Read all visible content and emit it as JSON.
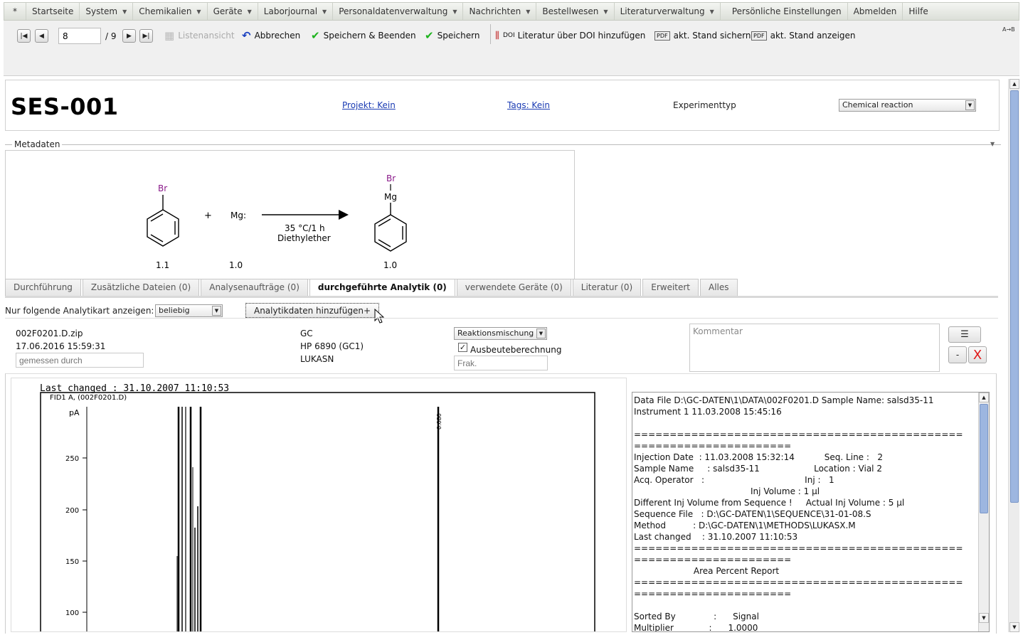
{
  "menu": {
    "items": [
      {
        "label": "*",
        "caret": false
      },
      {
        "label": "Startseite",
        "caret": false
      },
      {
        "label": "System",
        "caret": true
      },
      {
        "label": "Chemikalien",
        "caret": true
      },
      {
        "label": "Geräte",
        "caret": true
      },
      {
        "label": "Laborjournal",
        "caret": true
      },
      {
        "label": "Personaldatenverwaltung",
        "caret": true
      },
      {
        "label": "Nachrichten",
        "caret": true
      },
      {
        "label": "Bestellwesen",
        "caret": true
      },
      {
        "label": "Literaturverwaltung",
        "caret": true
      },
      {
        "label": "Persönliche Einstellungen",
        "caret": false
      },
      {
        "label": "Abmelden",
        "caret": false
      },
      {
        "label": "Hilfe",
        "caret": false
      }
    ]
  },
  "toolbar": {
    "page_value": "8",
    "page_total": "/ 9",
    "list_view": "Listenansicht",
    "cancel": "Abbrechen",
    "save_close": "Speichern & Beenden",
    "save": "Speichern",
    "doi_badge": "DOI",
    "doi": "Literatur über DOI hinzufügen",
    "pdf_badge": "PDF",
    "save_state": "akt. Stand sichern",
    "show_state": "akt. Stand anzeigen",
    "expand": "A→B"
  },
  "header": {
    "title": "SES-001",
    "project_link": "Projekt: Kein",
    "tags_link": "Tags: Kein",
    "exptype_label": "Experimenttyp",
    "exptype_value": "Chemical reaction"
  },
  "metadata": {
    "legend": "Metadaten",
    "scheme": {
      "reactant1_atom": "Br",
      "plus": "+",
      "reactant2": "Mg:",
      "conditions_temp": "35 °C/1 h",
      "conditions_solvent": "Diethylether",
      "product_atom_top": "Br",
      "product_atom_mid": "Mg",
      "eq1": "1.1",
      "eq2": "1.0",
      "eq3": "1.0"
    }
  },
  "tabs": [
    {
      "label": "Durchführung",
      "active": false
    },
    {
      "label": "Zusätzliche Dateien (0)",
      "active": false
    },
    {
      "label": "Analysenaufträge (0)",
      "active": false
    },
    {
      "label": "durchgeführte Analytik (0)",
      "active": true
    },
    {
      "label": "verwendete Geräte (0)",
      "active": false
    },
    {
      "label": "Literatur (0)",
      "active": false
    },
    {
      "label": "Erweitert",
      "active": false
    },
    {
      "label": "Alles",
      "active": false
    }
  ],
  "analytics": {
    "filter_label": "Nur folgende Analytikart anzeigen:",
    "filter_value": "beliebig",
    "add_button": "Analytikdaten hinzufügen+",
    "file_name": "002F0201.D.zip",
    "file_date": "17.06.2016 15:59:31",
    "measured_by_placeholder": "gemessen durch",
    "method": "GC",
    "instrument": "HP 6890 (GC1)",
    "operator": "LUKASN",
    "sample_type": "Reaktionsmischung",
    "yield_calc_label": "Ausbeuteberechnung",
    "yield_calc_checked": true,
    "fraction_placeholder": "Frak.",
    "comment_placeholder": "Kommentar",
    "minus_label": "-",
    "delete_label": "X"
  },
  "chromatogram": {
    "header": "Last changed     : 31.10.2007 11:10:53",
    "signal_label": "FID1 A, (002F0201.D)",
    "yunit": "pA",
    "peak_label": "0.080",
    "ylabels": [
      "250",
      "200",
      "150",
      "100"
    ]
  },
  "report": {
    "lines": [
      "Data File D:\\GC-DATEN\\1\\DATA\\002F0201.D Sample Name: salsd35-11",
      "Instrument 1 11.03.2008 15:45:16",
      "",
      "==============================================",
      "======================",
      "Injection Date  : 11.03.2008 15:32:14           Seq. Line :   2",
      "Sample Name     : salsd35-11                    Location : Vial 2",
      "Acq. Operator   :                                     Inj :   1",
      "                                           Inj Volume : 1 µl",
      "Different Inj Volume from Sequence !     Actual Inj Volume : 5 µl",
      "Sequence File   : D:\\GC-DATEN\\1\\SEQUENCE\\31-01-08.S",
      "Method          : D:\\GC-DATEN\\1\\METHODS\\LUKASX.M",
      "Last changed    : 31.10.2007 11:10:53",
      "==============================================",
      "======================",
      "                      Area Percent Report",
      "==============================================",
      "======================",
      "",
      "Sorted By              :      Signal",
      "Multiplier             :      1.0000"
    ]
  }
}
